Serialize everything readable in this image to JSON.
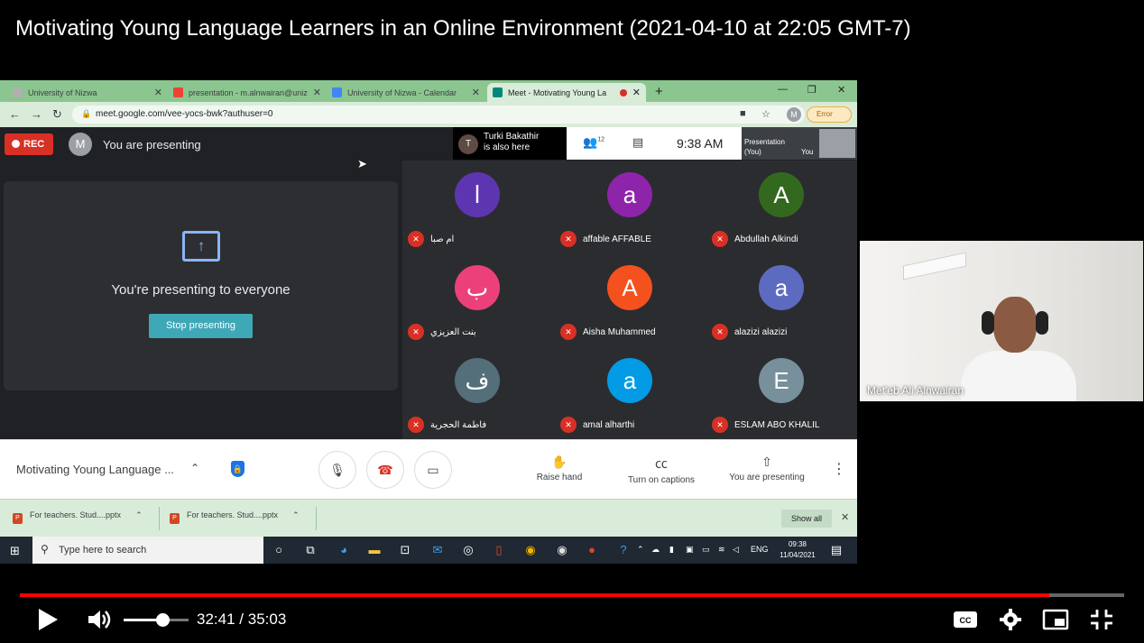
{
  "video_title": "Motivating Young Language Learners in an Online Environment (2021-04-10 at 22:05 GMT-7)",
  "browser": {
    "tabs": [
      {
        "label": "University of Nizwa",
        "icon": "university-icon",
        "active": false
      },
      {
        "label": "presentation - m.alnwairan@unizwa",
        "icon": "gmail-icon",
        "active": false
      },
      {
        "label": "University of Nizwa - Calendar",
        "icon": "calendar-icon",
        "active": false
      },
      {
        "label": "Meet - Motivating Young La",
        "icon": "meet-icon",
        "active": true
      }
    ],
    "url": "meet.google.com/vee-yocs-bwk?authuser=0",
    "profile_initial": "M",
    "error_label": "Error"
  },
  "meet": {
    "rec_label": "REC",
    "presenter_initial": "M",
    "presenting_banner": "You are presenting",
    "also_here_initial": "T",
    "also_here_name": "Turki Bakathir",
    "also_here_suffix": "is also here",
    "participant_count": "12",
    "time": "9:38 AM",
    "preview_label_1": "Presentation",
    "preview_label_2": "(You)",
    "preview_you": "You",
    "present_card": {
      "message": "You're presenting to everyone",
      "stop_label": "Stop presenting"
    },
    "participants": [
      {
        "initial": "ا",
        "name": "ام صبا",
        "color": "#5e35b1"
      },
      {
        "initial": "a",
        "name": "affable AFFABLE",
        "color": "#8e24aa"
      },
      {
        "initial": "A",
        "name": "Abdullah Alkindi",
        "color": "#33691e"
      },
      {
        "initial": "ب",
        "name": "بنت العزيزي",
        "color": "#ec407a"
      },
      {
        "initial": "A",
        "name": "Aisha Muhammed",
        "color": "#f4511e"
      },
      {
        "initial": "a",
        "name": "alazizi alazizi",
        "color": "#5c6bc0"
      },
      {
        "initial": "ف",
        "name": "فاطمة الحجرية",
        "color": "#546e7a"
      },
      {
        "initial": "a",
        "name": "amal alharthi",
        "color": "#039be5"
      },
      {
        "initial": "E",
        "name": "ESLAM ABO KHALIL",
        "color": "#78909c"
      }
    ],
    "bottom": {
      "meeting_name": "Motivating Young Language ...",
      "raise_hand": "Raise hand",
      "captions": "Turn on captions",
      "presenting": "You are presenting"
    }
  },
  "downloads": {
    "files": [
      "For teachers. Stud....pptx",
      "For teachers. Stud....pptx"
    ],
    "show_all": "Show all"
  },
  "taskbar": {
    "search_placeholder": "Type here to search",
    "lang": "ENG",
    "time": "09:38",
    "date": "11/04/2021"
  },
  "webcam": {
    "name": "Met'eb Ali Alnwairan"
  },
  "player": {
    "current_time": "32:41",
    "separator": "/",
    "duration": "35:03",
    "progress_fraction": 0.932,
    "volume_fraction": 0.6
  }
}
